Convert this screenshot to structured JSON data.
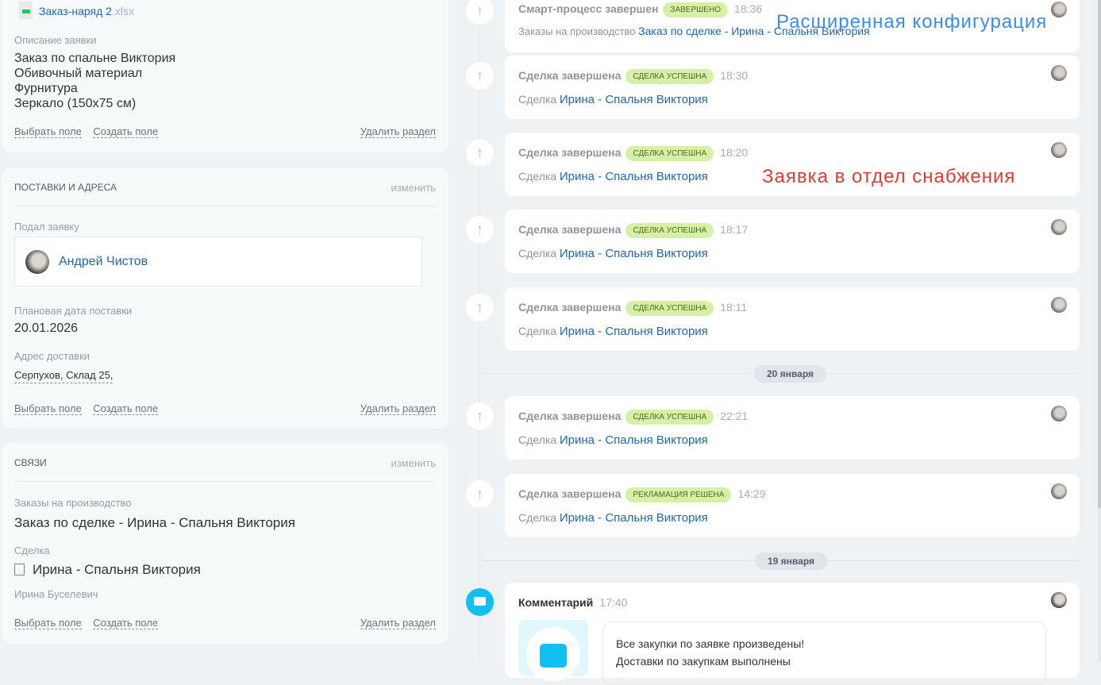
{
  "left": {
    "file": {
      "name": "Заказ-наряд 2",
      "ext": ".xlsx"
    },
    "description_label": "Описание заявки",
    "description_lines": [
      "Заказ по спальне Виктория",
      "Обивочный материал",
      "Фурнитура",
      "Зеркало (150x75 см)"
    ],
    "actions": {
      "select": "Выбрать поле",
      "create": "Создать поле",
      "delete": "Удалить раздел"
    },
    "delivery": {
      "title": "Поставки и адреса",
      "edit": "изменить",
      "submitted_label": "Подал заявку",
      "submitted_by": "Андрей Чистов",
      "date_label": "Плановая дата поставки",
      "date": "20.01.2026",
      "address_label": "Адрес доставки",
      "address": "Серпухов, Склад 25,"
    },
    "links": {
      "title": "Связи",
      "edit": "изменить",
      "orders_label": "Заказы на производство",
      "order": "Заказ по сделке - Ирина - Спальня Виктория",
      "deal_label": "Сделка",
      "deal": "Ирина - Спальня Виктория",
      "contact": "Ирина Буселевич"
    }
  },
  "timeline": {
    "top": {
      "title": "Смарт-процесс завершен",
      "badge": "Завершено",
      "time": "18:36",
      "prefix": "Заказы на производство",
      "link": "Заказ по сделке - Ирина - Спальня Виктория"
    },
    "events": [
      {
        "title": "Сделка завершена",
        "badge": "Сделка успешна",
        "time": "18:30",
        "prefix": "Сделка",
        "link": "Ирина - Спальня Виктория"
      },
      {
        "title": "Сделка завершена",
        "badge": "Сделка успешна",
        "time": "18:20",
        "prefix": "Сделка",
        "link": "Ирина - Спальня Виктория"
      },
      {
        "title": "Сделка завершена",
        "badge": "Сделка успешна",
        "time": "18:17",
        "prefix": "Сделка",
        "link": "Ирина - Спальня Виктория"
      },
      {
        "title": "Сделка завершена",
        "badge": "Сделка успешна",
        "time": "18:11",
        "prefix": "Сделка",
        "link": "Ирина - Спальня Виктория"
      },
      {
        "title": "Сделка завершена",
        "badge": "Сделка успешна",
        "time": "22:21",
        "prefix": "Сделка",
        "link": "Ирина - Спальня Виктория"
      },
      {
        "title": "Сделка завершена",
        "badge": "Рекламация решена",
        "time": "14:29",
        "prefix": "Сделка",
        "link": "Ирина - Спальня Виктория"
      }
    ],
    "dates": [
      "20 января",
      "19 января"
    ],
    "comment": {
      "title": "Комментарий",
      "time": "17:40",
      "lines": [
        "Все закупки по заявке произведены!",
        "Доставки по закупкам выполнены"
      ]
    }
  },
  "overlays": {
    "blue": "Расширенная конфигурация",
    "red": "Заявка в отдел снабжения"
  }
}
